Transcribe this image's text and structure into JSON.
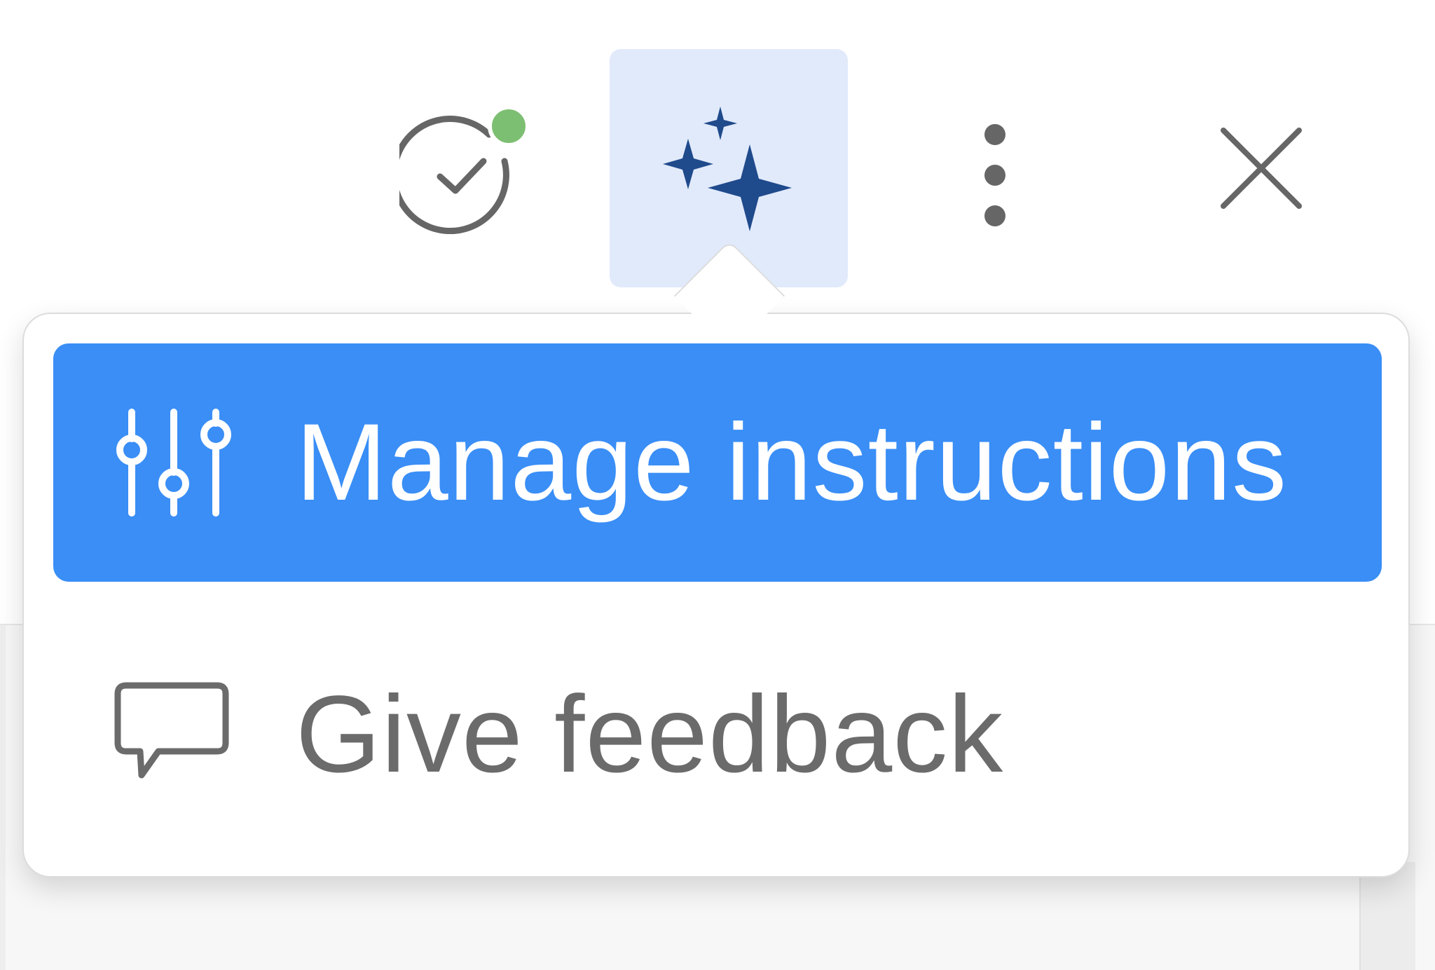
{
  "toolbar": {
    "status_indicator": {
      "icon": "check-circle-icon",
      "badge_color": "#7dbf72"
    },
    "assistant_button": {
      "icon": "sparkles-icon",
      "active": true,
      "highlight_color": "#e1eafb"
    },
    "more_button": {
      "icon": "vertical-ellipsis-icon"
    },
    "close_button": {
      "icon": "close-icon"
    }
  },
  "menu": {
    "items": [
      {
        "label": "Manage instructions",
        "icon": "sliders-icon",
        "highlighted": true
      },
      {
        "label": "Give feedback",
        "icon": "speech-bubble-icon",
        "highlighted": false
      }
    ],
    "highlight_color": "#3a8ef6"
  }
}
